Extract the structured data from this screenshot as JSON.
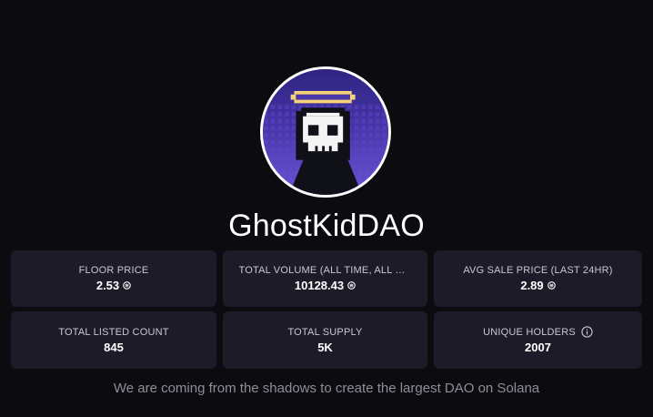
{
  "collection": {
    "name": "GhostKidDAO",
    "avatar_icon": "ghost-kid-avatar",
    "description": "We are coming from the shadows to create the largest DAO on Solana"
  },
  "stats": [
    {
      "label": "FLOOR PRICE",
      "value": "2.53",
      "currency_icon": "solana-icon"
    },
    {
      "label": "TOTAL VOLUME (ALL TIME, ALL MA...",
      "value": "10128.43",
      "currency_icon": "solana-icon"
    },
    {
      "label": "AVG SALE PRICE (LAST 24HR)",
      "value": "2.89",
      "currency_icon": "solana-icon"
    },
    {
      "label": "TOTAL LISTED COUNT",
      "value": "845"
    },
    {
      "label": "TOTAL SUPPLY",
      "value": "5K"
    },
    {
      "label": "UNIQUE HOLDERS",
      "value": "2007",
      "info_icon": "info-icon"
    }
  ],
  "colors": {
    "background": "#0c0b10",
    "card": "#1c1b27",
    "text": "#ffffff",
    "muted": "#8e8e99",
    "avatar_bg": "#4a36a8",
    "halo": "#f3d27a"
  }
}
